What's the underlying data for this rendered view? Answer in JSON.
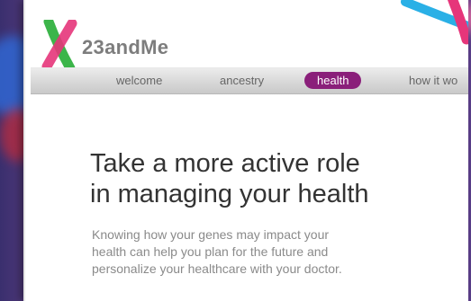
{
  "brand": {
    "name": "23andMe"
  },
  "nav": {
    "items": [
      {
        "label": "welcome"
      },
      {
        "label": "ancestry"
      },
      {
        "label": "health",
        "active": true
      },
      {
        "label": "how it wo"
      }
    ],
    "active_color": "#8a1f7a"
  },
  "main": {
    "headline_line1": "Take a more active role",
    "headline_line2": "in managing your health",
    "body_line1": "Knowing how your genes may impact your",
    "body_line2": "health can help you plan for the future and",
    "body_line3": "personalize your healthcare with your doctor."
  },
  "colors": {
    "logo_green": "#3cb54a",
    "logo_pink": "#e6357a",
    "logo_blue": "#2ab0e6"
  }
}
